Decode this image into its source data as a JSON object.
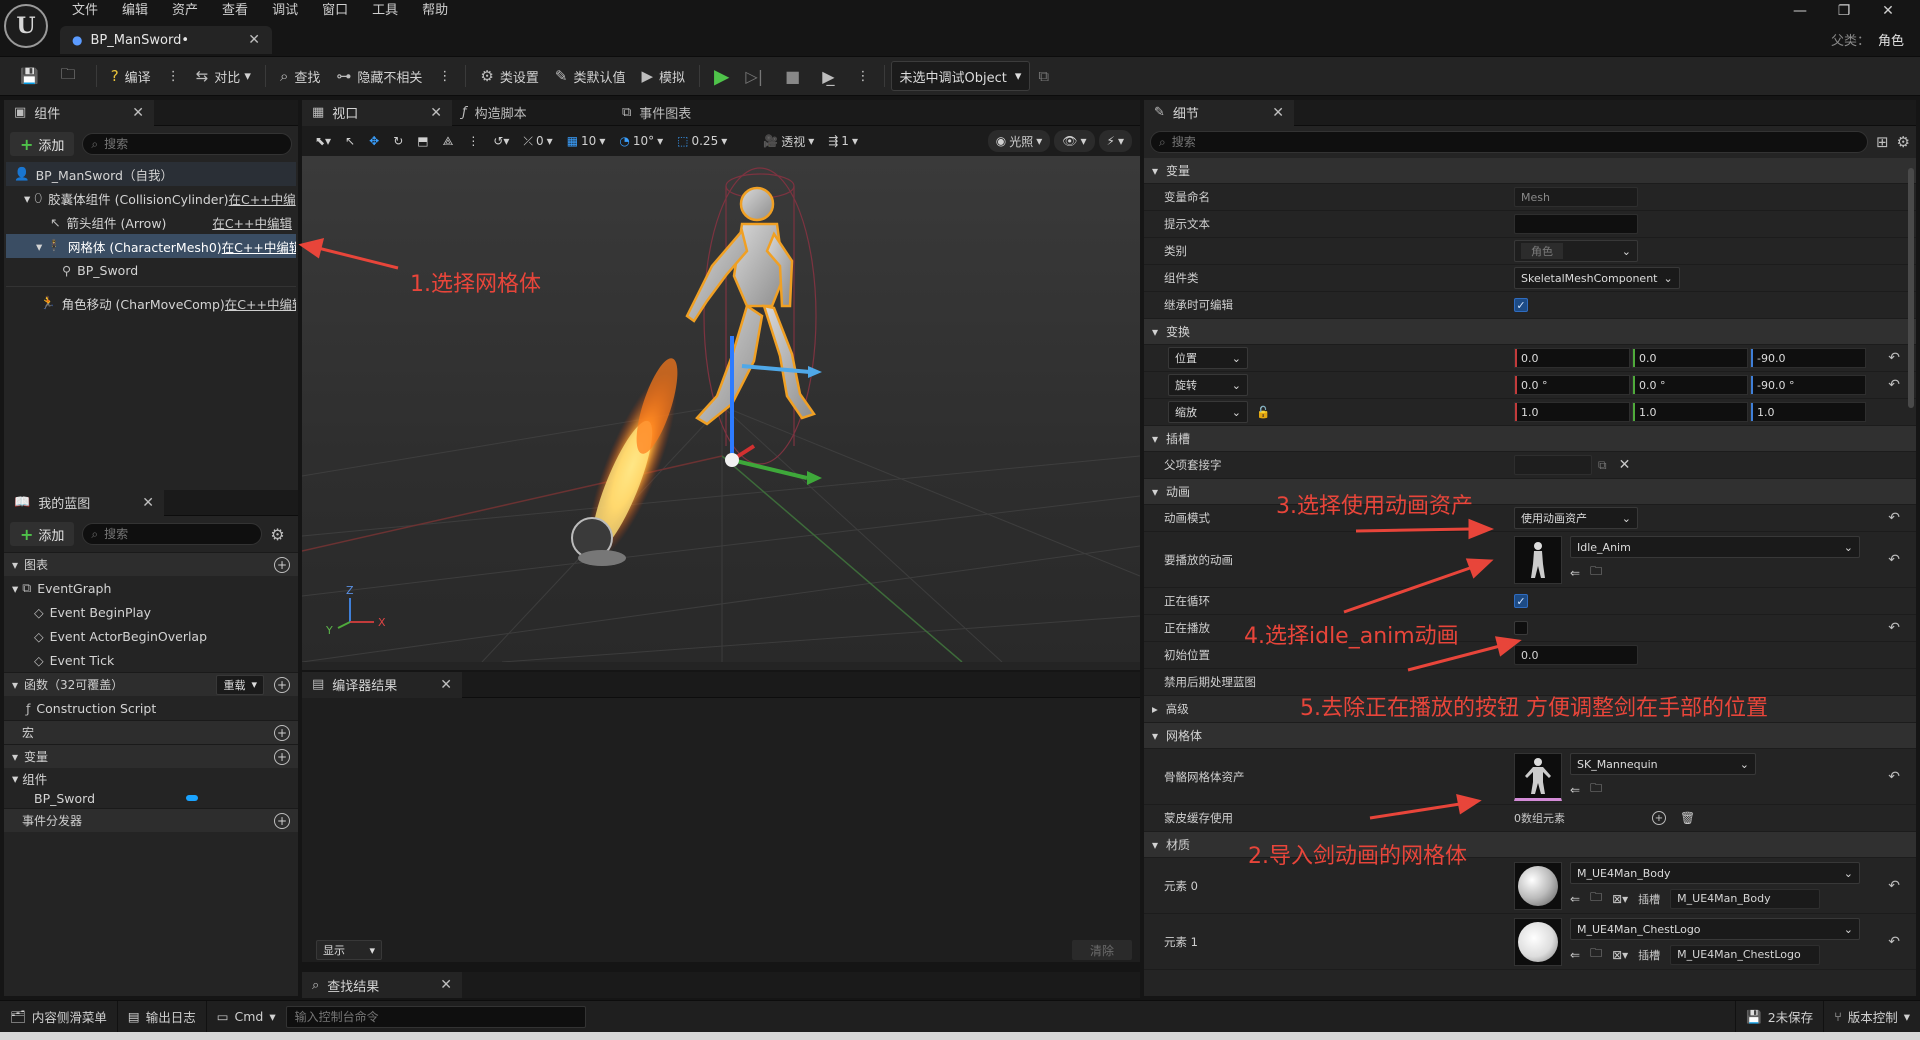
{
  "menu": [
    "文件",
    "编辑",
    "资产",
    "查看",
    "调试",
    "窗口",
    "工具",
    "帮助"
  ],
  "document_tab": "BP_ManSword•",
  "parent": {
    "label": "父类：",
    "value": "角色"
  },
  "toolbar": {
    "compile": "编译",
    "diff": "对比",
    "find": "查找",
    "hide_unrelated": "隐藏不相关",
    "class_settings": "类设置",
    "class_defaults": "类默认值",
    "simulate": "模拟",
    "debug_object": "未选中调试Object"
  },
  "components": {
    "tab": "组件",
    "add": "添加",
    "search_placeholder": "搜索",
    "items": [
      {
        "label": "BP_ManSword（自我）",
        "link": ""
      },
      {
        "label": "胶囊体组件 (CollisionCylinder)",
        "link": "在C++中编"
      },
      {
        "label": "箭头组件 (Arrow)",
        "link": "在C++中编辑"
      },
      {
        "label": "网格体 (CharacterMesh0)",
        "link": "在C++中编辑"
      },
      {
        "label": "BP_Sword",
        "link": ""
      },
      {
        "label": "角色移动 (CharMoveComp)",
        "link": "在C++中编辑"
      }
    ]
  },
  "my_blueprint": {
    "tab": "我的蓝图",
    "add": "添加",
    "search_placeholder": "搜索",
    "graph_section": "图表",
    "event_graph": "EventGraph",
    "events": [
      "Event BeginPlay",
      "Event ActorBeginOverlap",
      "Event Tick"
    ],
    "functions_section": "函数（32可覆盖）",
    "override": "重载",
    "construction": "Construction Script",
    "macros": "宏",
    "variables": "变量",
    "components_group": "组件",
    "sword_var": "BP_Sword",
    "dispatchers": "事件分发器"
  },
  "center_tabs": {
    "viewport": "视口",
    "construction": "构造脚本",
    "event_graph": "事件图表"
  },
  "viewport_toolbar": {
    "rot_snap": "0",
    "grid": "10",
    "angle": "10°",
    "scale": "0.25",
    "perspective": "透视",
    "lit": "光照",
    "speed": "1"
  },
  "compiler": {
    "tab": "编译器结果",
    "show": "显示",
    "clear": "清除"
  },
  "find_results": {
    "tab": "查找结果"
  },
  "details": {
    "tab": "细节",
    "search_placeholder": "搜索",
    "sec_variable": "变量",
    "var_name_label": "变量命名",
    "var_name": "Mesh",
    "tooltip_label": "提示文本",
    "category_label": "类别",
    "category": "角色",
    "component_class_label": "组件类",
    "component_class": "SkeletalMeshComponent",
    "editable_label": "继承时可编辑",
    "sec_transform": "变换",
    "location": "位置",
    "loc": [
      "0.0",
      "0.0",
      "-90.0"
    ],
    "rotation": "旋转",
    "rot": [
      "0.0 °",
      "0.0 °",
      "-90.0 °"
    ],
    "scale": "缩放",
    "scl": [
      "1.0",
      "1.0",
      "1.0"
    ],
    "sec_socket": "插槽",
    "parent_socket": "父项套接字",
    "sec_animation": "动画",
    "anim_mode_label": "动画模式",
    "anim_mode": "使用动画资产",
    "anim_to_play_label": "要播放的动画",
    "anim_to_play": "Idle_Anim",
    "looping_label": "正在循环",
    "playing_label": "正在播放",
    "initial_pos_label": "初始位置",
    "initial_pos": "0.0",
    "disable_post_label": "禁用后期处理蓝图",
    "advanced": "高级",
    "sec_mesh": "网格体",
    "skel_mesh_label": "骨骼网格体资产",
    "skel_mesh": "SK_Mannequin",
    "skin_cache_label": "蒙皮缓存使用",
    "skin_cache": "0数组元素",
    "sec_materials": "材质",
    "element0": "元素 0",
    "mat0": "M_UE4Man_Body",
    "slot0": "M_UE4Man_Body",
    "element1": "元素 1",
    "mat1": "M_UE4Man_ChestLogo",
    "slot1": "M_UE4Man_ChestLogo",
    "slot_label": "插槽"
  },
  "annotations": {
    "a1": "1.选择网格体",
    "a2": "2.导入剑动画的网格体",
    "a3": "3.选择使用动画资产",
    "a4": "4.选择idle_anim动画",
    "a5": "5.去除正在播放的按钮 方便调整剑在手部的位置"
  },
  "status": {
    "content_drawer": "内容侧滑菜单",
    "output_log": "输出日志",
    "cmd": "Cmd",
    "console_placeholder": "输入控制台命令",
    "unsaved": "2未保存",
    "source_control": "版本控制"
  }
}
